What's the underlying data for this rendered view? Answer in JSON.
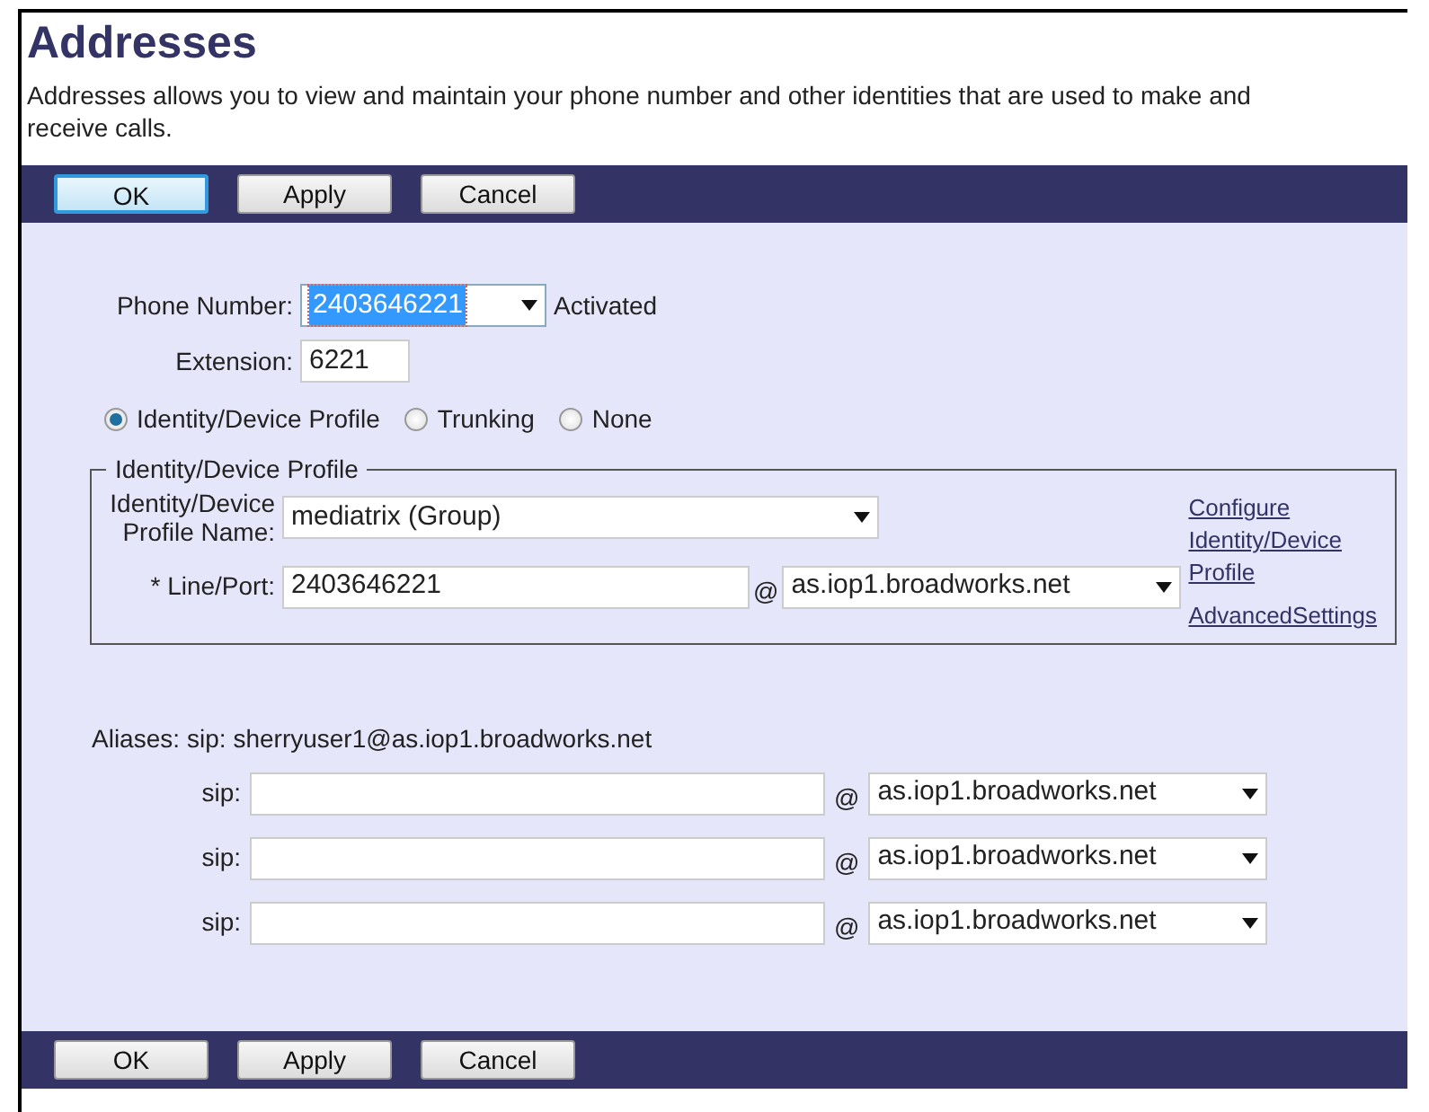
{
  "title": "Addresses",
  "description": "Addresses allows you to view and maintain your phone number and other identities that are used to make and receive calls.",
  "top_buttons": [
    {
      "label": "OK",
      "focused": true
    },
    {
      "label": "Apply",
      "focused": false
    },
    {
      "label": "Cancel",
      "focused": false
    }
  ],
  "phone_number": {
    "label": "Phone Number:",
    "value": "2403646221",
    "highlighted": true,
    "status": "Activated"
  },
  "extension": {
    "label": "Extension:",
    "value": "6221"
  },
  "modes": [
    {
      "label": "Identity/Device Profile",
      "selected": true
    },
    {
      "label": "Trunking",
      "selected": false
    },
    {
      "label": "None",
      "selected": false
    }
  ],
  "profile_group": {
    "legend": "Identity/Device Profile",
    "profile_name": {
      "label": "Identity/Device Profile Name:",
      "value": "mediatrix (Group)"
    },
    "line_port": {
      "label": "* Line/Port:",
      "value": "2403646221",
      "at": "@",
      "domain": "as.iop1.broadworks.net"
    },
    "configure_link": "Configure Identity/Device Profile",
    "advanced_link": "AdvancedSettings"
  },
  "aliases": {
    "label": "Aliases:",
    "primary": "sip: sherryuser1@as.iop1.broadworks.net",
    "rows": [
      {
        "label": "sip:",
        "at": "@",
        "domain": "as.iop1.broadworks.net"
      },
      {
        "label": "sip:",
        "at": "@",
        "domain": "as.iop1.broadworks.net"
      },
      {
        "label": "sip:",
        "at": "@",
        "domain": "as.iop1.broadworks.net"
      }
    ]
  },
  "bottom_buttons": [
    {
      "label": "OK",
      "focused": false
    },
    {
      "label": "Apply",
      "focused": false
    },
    {
      "label": "Cancel",
      "focused": false
    }
  ]
}
